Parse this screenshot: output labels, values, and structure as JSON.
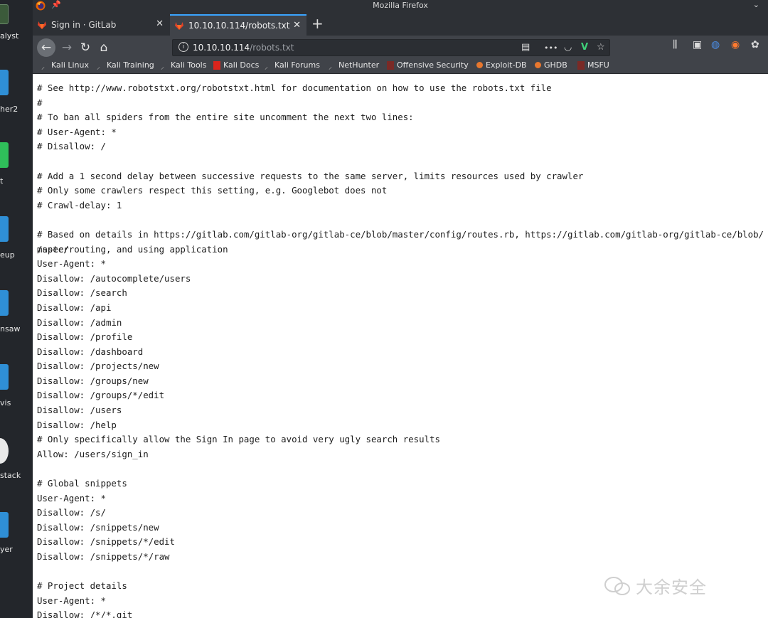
{
  "window": {
    "title": "Mozilla Firefox"
  },
  "desktop": {
    "items": [
      {
        "label": "alyst"
      },
      {
        "label": "her2"
      },
      {
        "label": "t"
      },
      {
        "label": "eup"
      },
      {
        "label": "nsaw"
      },
      {
        "label": "vis"
      },
      {
        "label": "stack"
      },
      {
        "label": "yer"
      }
    ]
  },
  "tabs": [
    {
      "label": "Sign in · GitLab",
      "active": false
    },
    {
      "label": "10.10.10.114/robots.txt",
      "active": true
    }
  ],
  "navbar": {
    "url_host": "10.10.10.114",
    "url_path": "/robots.txt",
    "more_label": "•••"
  },
  "bookmarks": [
    {
      "label": "Kali Linux"
    },
    {
      "label": "Kali Training"
    },
    {
      "label": "Kali Tools"
    },
    {
      "label": "Kali Docs"
    },
    {
      "label": "Kali Forums"
    },
    {
      "label": "NetHunter"
    },
    {
      "label": "Offensive Security"
    },
    {
      "label": "Exploit-DB"
    },
    {
      "label": "GHDB"
    },
    {
      "label": "MSFU"
    }
  ],
  "content": {
    "lines": [
      "# See http://www.robotstxt.org/robotstxt.html for documentation on how to use the robots.txt file",
      "#",
      "# To ban all spiders from the entire site uncomment the next two lines:",
      "# User-Agent: *",
      "# Disallow: /",
      "",
      "# Add a 1 second delay between successive requests to the same server, limits resources used by crawler",
      "# Only some crawlers respect this setting, e.g. Googlebot does not",
      "# Crawl-delay: 1",
      "",
      "# Based on details in https://gitlab.com/gitlab-org/gitlab-ce/blob/master/config/routes.rb, https://gitlab.com/gitlab-org/gitlab-ce/blob/master",
      "/spec/routing, and using application",
      "User-Agent: *",
      "Disallow: /autocomplete/users",
      "Disallow: /search",
      "Disallow: /api",
      "Disallow: /admin",
      "Disallow: /profile",
      "Disallow: /dashboard",
      "Disallow: /projects/new",
      "Disallow: /groups/new",
      "Disallow: /groups/*/edit",
      "Disallow: /users",
      "Disallow: /help",
      "# Only specifically allow the Sign In page to avoid very ugly search results",
      "Allow: /users/sign_in",
      "",
      "# Global snippets",
      "User-Agent: *",
      "Disallow: /s/",
      "Disallow: /snippets/new",
      "Disallow: /snippets/*/edit",
      "Disallow: /snippets/*/raw",
      "",
      "# Project details",
      "User-Agent: *",
      "Disallow: /*/*.git"
    ]
  },
  "watermark": {
    "text": "大余安全"
  },
  "colors": {
    "chrome_dark": "#2d3035",
    "chrome_toolbar": "#404349",
    "active_tab_accent": "#3aa4ff",
    "page_bg": "#ffffff"
  }
}
